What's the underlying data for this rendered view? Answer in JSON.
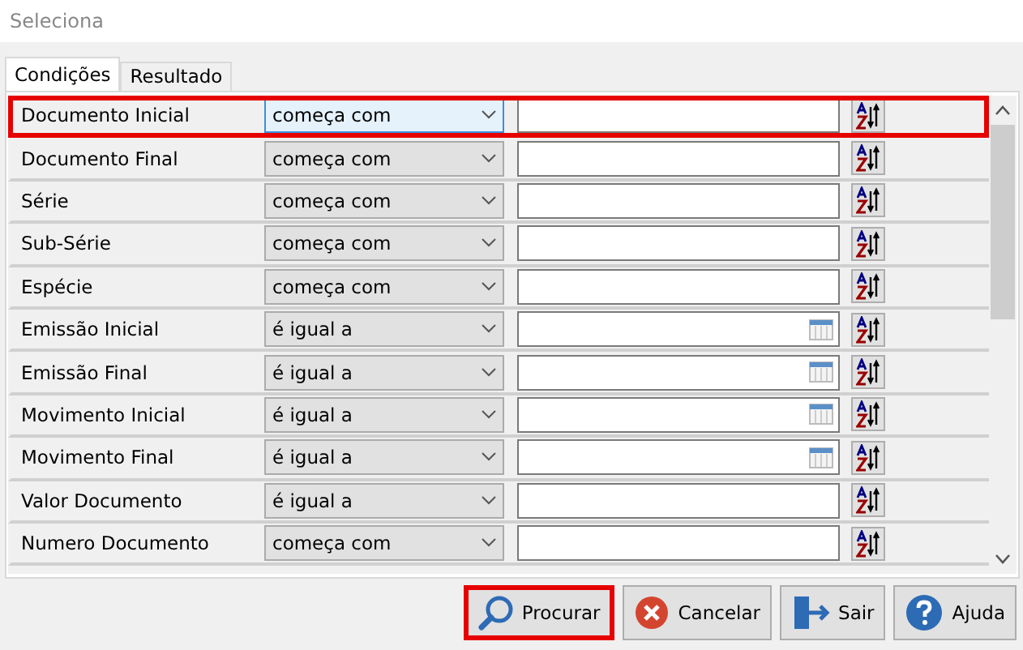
{
  "window": {
    "title": "Seleciona"
  },
  "tabs": [
    {
      "label": "Condições",
      "selected": true
    },
    {
      "label": "Resultado",
      "selected": false
    }
  ],
  "rows": [
    {
      "field": "Documento Inicial",
      "operator": "começa com",
      "kind": "text",
      "selected": true
    },
    {
      "field": "Documento Final",
      "operator": "começa com",
      "kind": "text",
      "selected": false
    },
    {
      "field": "Série",
      "operator": "começa com",
      "kind": "text",
      "selected": false
    },
    {
      "field": "Sub-Série",
      "operator": "começa com",
      "kind": "text",
      "selected": false
    },
    {
      "field": "Espécie",
      "operator": "começa com",
      "kind": "text",
      "selected": false
    },
    {
      "field": "Emissão Inicial",
      "operator": "é igual a",
      "kind": "date",
      "selected": false
    },
    {
      "field": "Emissão Final",
      "operator": "é igual a",
      "kind": "date",
      "selected": false
    },
    {
      "field": "Movimento Inicial",
      "operator": "é igual a",
      "kind": "date",
      "selected": false
    },
    {
      "field": "Movimento Final",
      "operator": "é igual a",
      "kind": "date",
      "selected": false
    },
    {
      "field": "Valor Documento",
      "operator": "é igual a",
      "kind": "text",
      "selected": false
    },
    {
      "field": "Numero Documento",
      "operator": "começa com",
      "kind": "text",
      "selected": false
    }
  ],
  "buttons": [
    {
      "label": "Procurar",
      "kind": "search",
      "selected": true
    },
    {
      "label": "Cancelar",
      "kind": "cancel",
      "selected": false
    },
    {
      "label": "Sair",
      "kind": "exit",
      "selected": false
    },
    {
      "label": "Ajuda",
      "kind": "help",
      "selected": false
    }
  ]
}
